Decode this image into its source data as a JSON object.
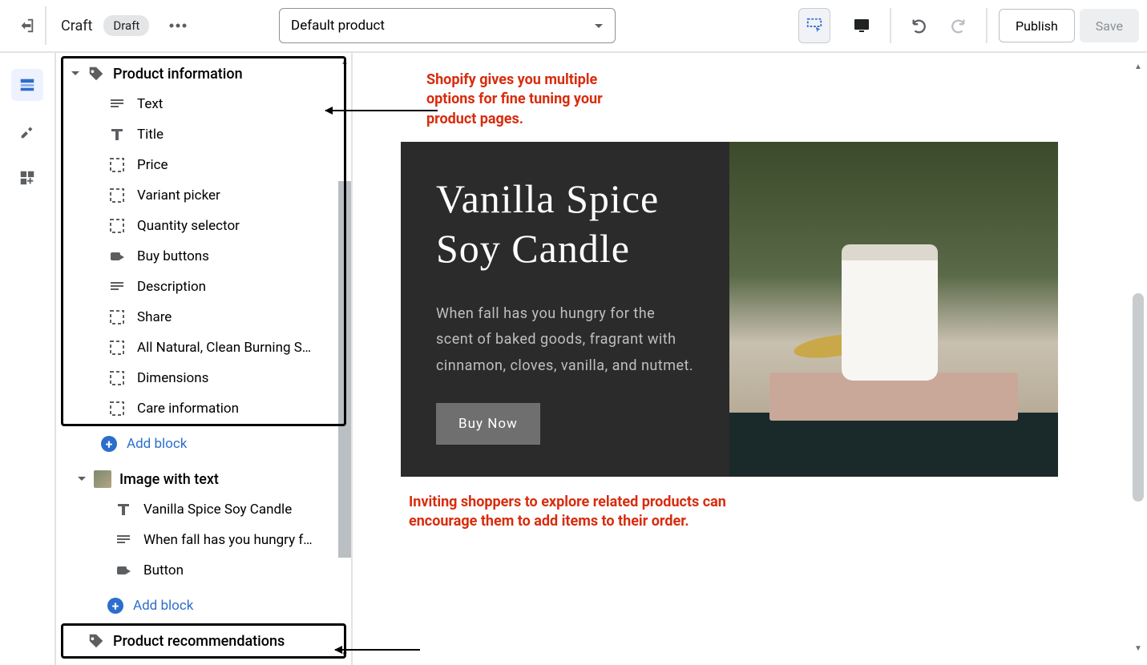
{
  "header": {
    "title": "Craft",
    "status": "Draft",
    "template_select": "Default product",
    "publish": "Publish",
    "save": "Save"
  },
  "sidebar": {
    "sections": [
      {
        "title": "Product information",
        "boxed": true,
        "icon": "tag",
        "items": [
          {
            "icon": "text",
            "label": "Text"
          },
          {
            "icon": "title",
            "label": "Title"
          },
          {
            "icon": "box",
            "label": "Price"
          },
          {
            "icon": "box",
            "label": "Variant picker"
          },
          {
            "icon": "box",
            "label": "Quantity selector"
          },
          {
            "icon": "buy",
            "label": "Buy buttons"
          },
          {
            "icon": "text",
            "label": "Description"
          },
          {
            "icon": "box",
            "label": "Share"
          },
          {
            "icon": "box",
            "label": "All Natural, Clean Burning S…"
          },
          {
            "icon": "box",
            "label": "Dimensions"
          },
          {
            "icon": "box",
            "label": "Care information"
          }
        ],
        "add_block": "Add block"
      },
      {
        "title": "Image with text",
        "boxed": false,
        "icon": "image",
        "items": [
          {
            "icon": "title",
            "label": "Vanilla Spice Soy Candle"
          },
          {
            "icon": "text",
            "label": "When fall has you hungry f…"
          },
          {
            "icon": "buy",
            "label": "Button"
          }
        ],
        "add_block": "Add block"
      }
    ],
    "bottom_section": "Product recommendations"
  },
  "annotations": {
    "note1": "Shopify gives you multiple options for fine tuning your product pages.",
    "note2": "Inviting shoppers to explore related products can encourage them to add items to their order."
  },
  "preview": {
    "title": "Vanilla Spice Soy Candle",
    "description": "When fall has you hungry for the scent of baked goods, fragrant with cinnamon, cloves, vanilla, and nutmet.",
    "button": "Buy Now"
  }
}
